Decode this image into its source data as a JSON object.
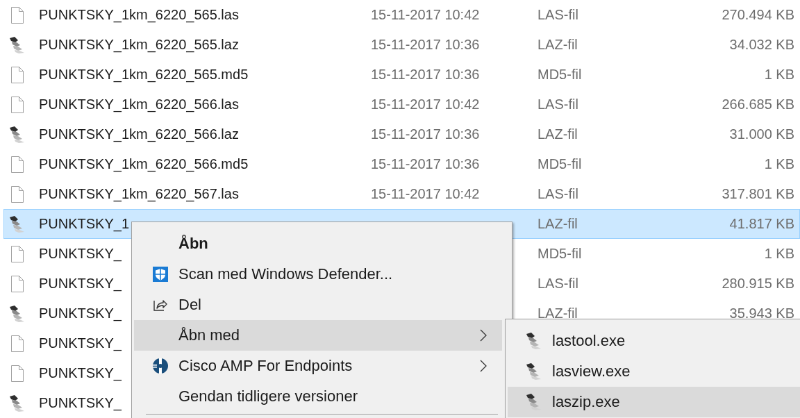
{
  "files": [
    {
      "kind": "las",
      "name": "PUNKTSKY_1km_6220_565.las",
      "date": "15-11-2017 10:42",
      "type": "LAS-fil",
      "size": "270.494 KB",
      "selected": false
    },
    {
      "kind": "laz",
      "name": "PUNKTSKY_1km_6220_565.laz",
      "date": "15-11-2017 10:36",
      "type": "LAZ-fil",
      "size": "34.032 KB",
      "selected": false
    },
    {
      "kind": "md5",
      "name": "PUNKTSKY_1km_6220_565.md5",
      "date": "15-11-2017 10:36",
      "type": "MD5-fil",
      "size": "1 KB",
      "selected": false
    },
    {
      "kind": "las",
      "name": "PUNKTSKY_1km_6220_566.las",
      "date": "15-11-2017 10:42",
      "type": "LAS-fil",
      "size": "266.685 KB",
      "selected": false
    },
    {
      "kind": "laz",
      "name": "PUNKTSKY_1km_6220_566.laz",
      "date": "15-11-2017 10:36",
      "type": "LAZ-fil",
      "size": "31.000 KB",
      "selected": false
    },
    {
      "kind": "md5",
      "name": "PUNKTSKY_1km_6220_566.md5",
      "date": "15-11-2017 10:36",
      "type": "MD5-fil",
      "size": "1 KB",
      "selected": false
    },
    {
      "kind": "las",
      "name": "PUNKTSKY_1km_6220_567.las",
      "date": "15-11-2017 10:42",
      "type": "LAS-fil",
      "size": "317.801 KB",
      "selected": false
    },
    {
      "kind": "laz",
      "name": "PUNKTSKY_1",
      "type": "LAZ-fil",
      "size": "41.817 KB",
      "selected": true
    },
    {
      "kind": "md5",
      "name": "PUNKTSKY_",
      "type": "MD5-fil",
      "size": "1 KB",
      "selected": false
    },
    {
      "kind": "las",
      "name": "PUNKTSKY_",
      "type": "LAS-fil",
      "size": "280.915 KB",
      "selected": false
    },
    {
      "kind": "laz",
      "name": "PUNKTSKY_",
      "type": "LAZ-fil",
      "size": "35.943 KB",
      "selected": false
    },
    {
      "kind": "las",
      "name": "PUNKTSKY_",
      "selected": false
    },
    {
      "kind": "md5",
      "name": "PUNKTSKY_",
      "selected": false
    },
    {
      "kind": "laz",
      "name": "PUNKTSKY_",
      "selected": false
    }
  ],
  "context_menu": {
    "items": [
      {
        "label": "Åbn",
        "default": true,
        "kind": "plain",
        "submenu": false,
        "selected": false
      },
      {
        "label": "Scan med Windows Defender...",
        "default": false,
        "kind": "shield",
        "submenu": false,
        "selected": false
      },
      {
        "label": "Del",
        "default": false,
        "kind": "share",
        "submenu": false,
        "selected": false
      },
      {
        "label": "Åbn med",
        "default": false,
        "kind": "plain",
        "submenu": true,
        "selected": true
      },
      {
        "label": "Cisco AMP For Endpoints",
        "default": false,
        "kind": "cisco",
        "submenu": true,
        "selected": false
      },
      {
        "label": "Gendan tidligere versioner",
        "default": false,
        "kind": "plain",
        "submenu": false,
        "selected": false
      }
    ]
  },
  "submenu": {
    "items": [
      {
        "label": "lastool.exe",
        "selected": false
      },
      {
        "label": "lasview.exe",
        "selected": false
      },
      {
        "label": "laszip.exe",
        "selected": true
      }
    ]
  }
}
